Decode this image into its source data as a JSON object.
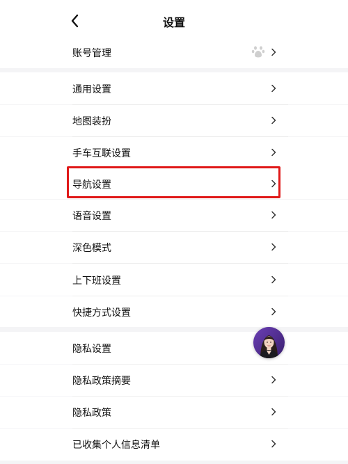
{
  "header": {
    "title": "设置",
    "back_icon": "chevron-left-icon"
  },
  "groups": [
    {
      "items": [
        {
          "label": "账号管理",
          "trailing_icon": "baidu-paw-icon"
        }
      ]
    },
    {
      "items": [
        {
          "label": "通用设置"
        },
        {
          "label": "地图装扮"
        },
        {
          "label": "手车互联设置"
        },
        {
          "label": "导航设置",
          "highlighted": true
        },
        {
          "label": "语音设置"
        },
        {
          "label": "深色模式"
        },
        {
          "label": "上下班设置"
        },
        {
          "label": "快捷方式设置"
        }
      ]
    },
    {
      "items": [
        {
          "label": "隐私设置"
        },
        {
          "label": "隐私政策摘要"
        },
        {
          "label": "隐私政策"
        },
        {
          "label": "已收集个人信息清单"
        }
      ]
    }
  ],
  "floating_assistant": {
    "icon": "assistant-avatar"
  },
  "colors": {
    "highlight_border": "#e01919",
    "background": "#f4f4f6",
    "row": "#ffffff"
  }
}
